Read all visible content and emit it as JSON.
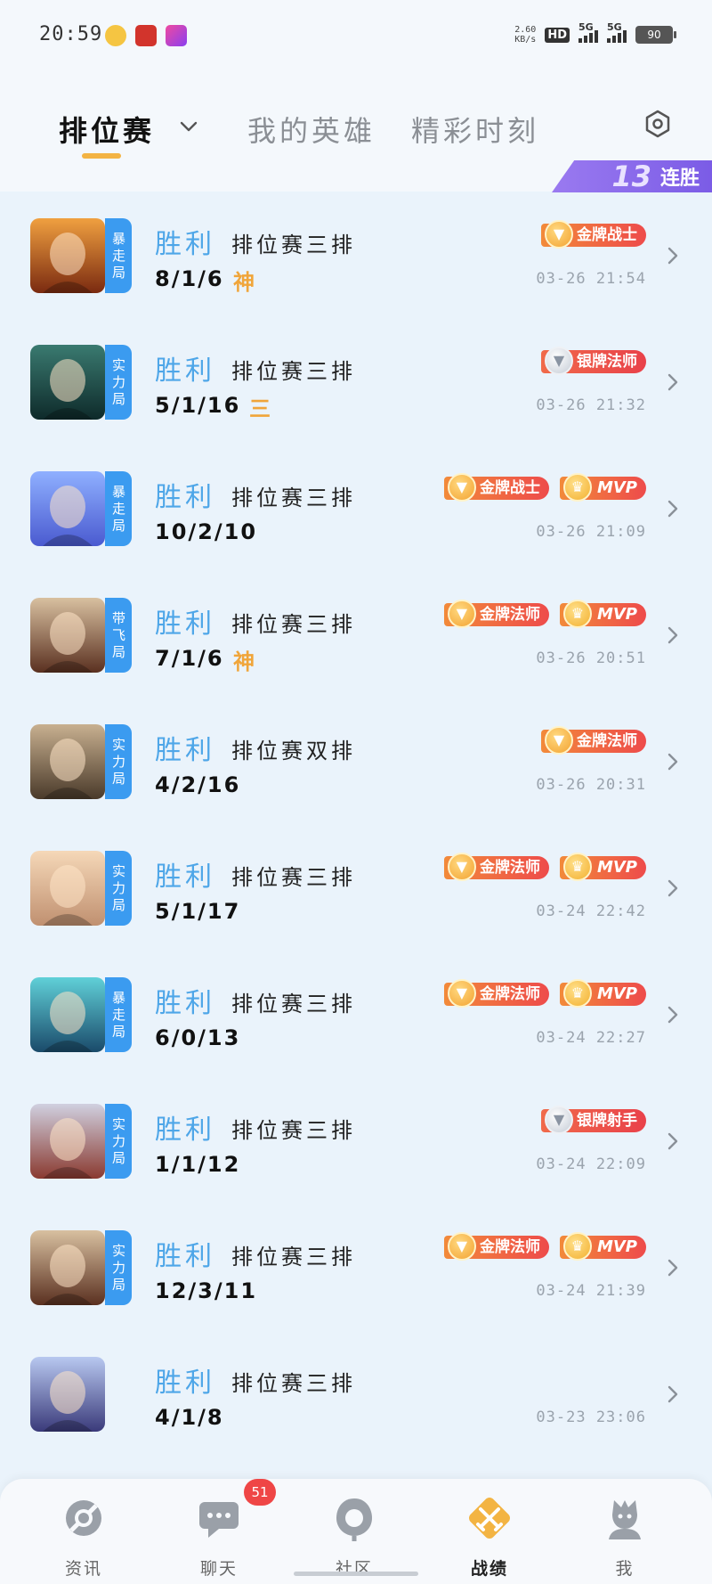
{
  "status_bar": {
    "time": "20:59",
    "net_speed_value": "2.60",
    "net_speed_unit": "KB/s",
    "hd_label": "HD",
    "sim1_label": "5G",
    "sim2_label": "5G",
    "battery": "90"
  },
  "tabs": [
    {
      "label": "排位赛"
    },
    {
      "label": "我的英雄"
    },
    {
      "label": "精彩时刻"
    }
  ],
  "streak": {
    "count": "13",
    "label": "连胜"
  },
  "matches": [
    {
      "result": "胜利",
      "type": "排位赛三排",
      "kda": "8/1/6",
      "kda_badge": "神",
      "mode": "暴走局",
      "medals": [
        {
          "kind": "gold",
          "label": "金牌战士"
        }
      ],
      "time": "03-26 21:54",
      "avatar_colors": [
        "#f0a040",
        "#7a2a10"
      ]
    },
    {
      "result": "胜利",
      "type": "排位赛三排",
      "kda": "5/1/16",
      "kda_badge": "三",
      "mode": "实力局",
      "medals": [
        {
          "kind": "silver",
          "label": "银牌法师"
        }
      ],
      "time": "03-26 21:32",
      "avatar_colors": [
        "#3a7a70",
        "#0e2a2a"
      ]
    },
    {
      "result": "胜利",
      "type": "排位赛三排",
      "kda": "10/2/10",
      "kda_badge": "",
      "mode": "暴走局",
      "medals": [
        {
          "kind": "gold",
          "label": "金牌战士"
        },
        {
          "kind": "mvp",
          "label": "MVP"
        }
      ],
      "time": "03-26 21:09",
      "avatar_colors": [
        "#8fb0ff",
        "#4a5ad0"
      ]
    },
    {
      "result": "胜利",
      "type": "排位赛三排",
      "kda": "7/1/6",
      "kda_badge": "神",
      "mode": "带飞局",
      "medals": [
        {
          "kind": "gold",
          "label": "金牌法师"
        },
        {
          "kind": "mvp",
          "label": "MVP"
        }
      ],
      "time": "03-26 20:51",
      "avatar_colors": [
        "#d8c0a0",
        "#5a3020"
      ]
    },
    {
      "result": "胜利",
      "type": "排位赛双排",
      "kda": "4/2/16",
      "kda_badge": "",
      "mode": "实力局",
      "medals": [
        {
          "kind": "gold",
          "label": "金牌法师"
        }
      ],
      "time": "03-26 20:31",
      "avatar_colors": [
        "#c8b090",
        "#4a3a2a"
      ]
    },
    {
      "result": "胜利",
      "type": "排位赛三排",
      "kda": "5/1/17",
      "kda_badge": "",
      "mode": "实力局",
      "medals": [
        {
          "kind": "gold",
          "label": "金牌法师"
        },
        {
          "kind": "mvp",
          "label": "MVP"
        }
      ],
      "time": "03-24 22:42",
      "avatar_colors": [
        "#f5d8b8",
        "#c09070"
      ]
    },
    {
      "result": "胜利",
      "type": "排位赛三排",
      "kda": "6/0/13",
      "kda_badge": "",
      "mode": "暴走局",
      "medals": [
        {
          "kind": "gold",
          "label": "金牌法师"
        },
        {
          "kind": "mvp",
          "label": "MVP"
        }
      ],
      "time": "03-24 22:27",
      "avatar_colors": [
        "#60d0d8",
        "#1a4a6a"
      ]
    },
    {
      "result": "胜利",
      "type": "排位赛三排",
      "kda": "1/1/12",
      "kda_badge": "",
      "mode": "实力局",
      "medals": [
        {
          "kind": "silver",
          "label": "银牌射手"
        }
      ],
      "time": "03-24 22:09",
      "avatar_colors": [
        "#d0d0e0",
        "#8a3a30"
      ]
    },
    {
      "result": "胜利",
      "type": "排位赛三排",
      "kda": "12/3/11",
      "kda_badge": "",
      "mode": "实力局",
      "medals": [
        {
          "kind": "gold",
          "label": "金牌法师"
        },
        {
          "kind": "mvp",
          "label": "MVP"
        }
      ],
      "time": "03-24 21:39",
      "avatar_colors": [
        "#d8c0a0",
        "#5a3020"
      ]
    },
    {
      "result": "胜利",
      "type": "排位赛三排",
      "kda": "4/1/8",
      "kda_badge": "",
      "mode": "",
      "medals": [],
      "time": "03-23 23:06",
      "avatar_colors": [
        "#b8c8f0",
        "#3a3a7a"
      ]
    }
  ],
  "bottom_nav": [
    {
      "label": "资讯",
      "icon": "news-icon"
    },
    {
      "label": "聊天",
      "icon": "chat-icon"
    },
    {
      "label": "社区",
      "icon": "community-icon"
    },
    {
      "label": "战绩",
      "icon": "battle-record-icon"
    },
    {
      "label": "我",
      "icon": "profile-icon"
    }
  ],
  "chat_unread": "51",
  "colors": {
    "accent": "#f3b443",
    "result_blue": "#4ea6e8",
    "mode_tag": "#3b9bf0",
    "medal_red": "#ee4b4b",
    "streak_purple": "#7b5ce6"
  }
}
